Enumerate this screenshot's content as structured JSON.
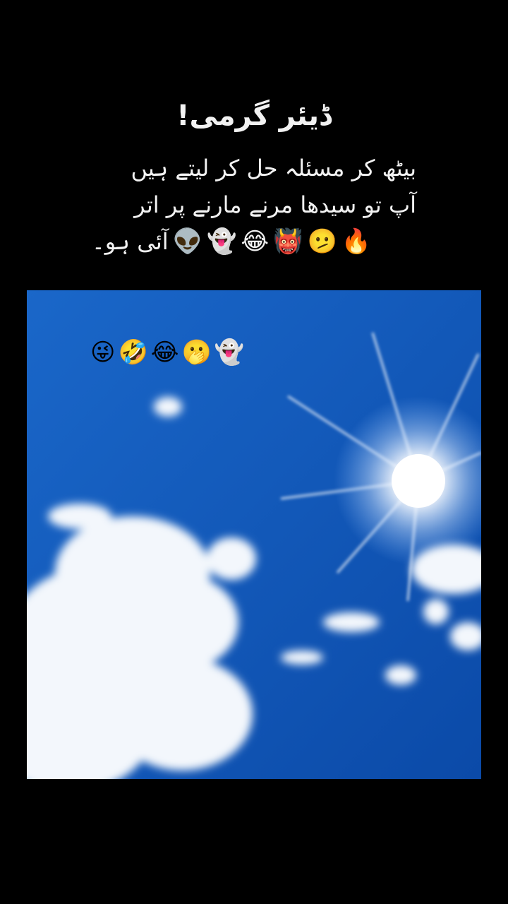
{
  "caption": {
    "title": "ڈیئر گرمی!",
    "line1": "بیٹھ کر مسئلہ حل کر لیتے ہیں",
    "line2": "آپ تو سیدھا مرنے مارنے پر اتر",
    "line3": "آئی ہو۔",
    "line3_emojis": [
      "🔥",
      "🫤",
      "👹",
      "😂",
      "👻",
      "👽"
    ]
  },
  "photo": {
    "description_colors": {
      "sky_top": "#1b62c4",
      "sky_bottom": "#0c4fb0",
      "sun": "#ffffff"
    },
    "emojis": [
      "😜",
      "🤣",
      "😂",
      "🫢",
      "👻"
    ]
  }
}
